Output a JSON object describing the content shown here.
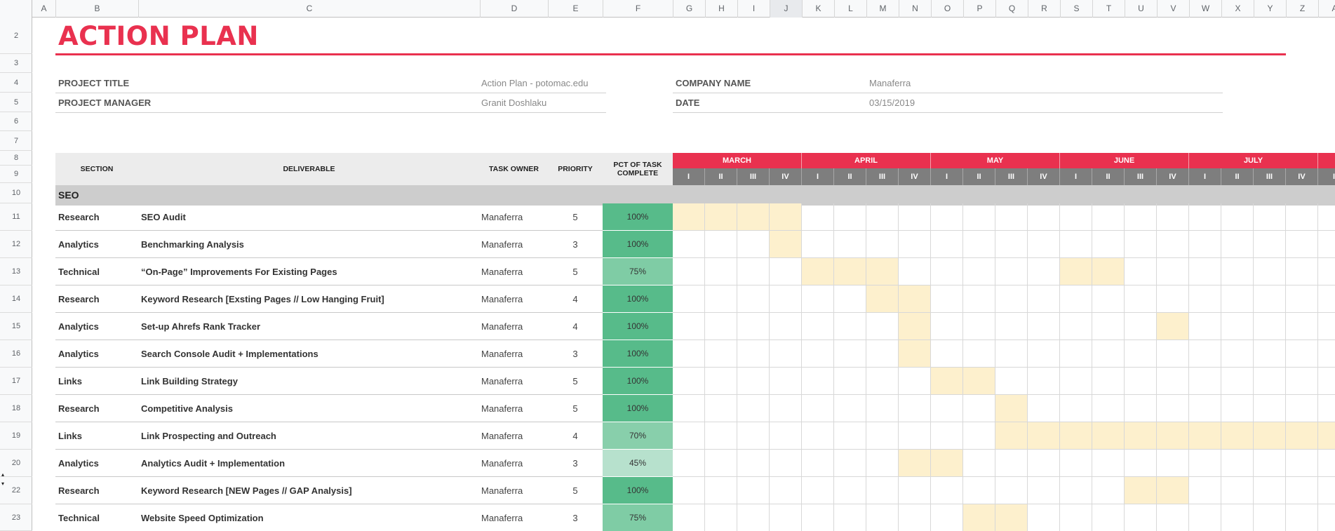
{
  "column_headers": [
    "A",
    "B",
    "C",
    "D",
    "E",
    "F",
    "G",
    "H",
    "I",
    "J",
    "K",
    "L",
    "M",
    "N",
    "O",
    "P",
    "Q",
    "R",
    "S",
    "T",
    "U",
    "V",
    "W",
    "X",
    "Y",
    "Z",
    "A"
  ],
  "selected_column": "J",
  "row_headers": [
    "2",
    "3",
    "4",
    "5",
    "6",
    "7",
    "8",
    "9",
    "10",
    "11",
    "12",
    "13",
    "14",
    "15",
    "16",
    "17",
    "18",
    "19",
    "20",
    "22",
    "23"
  ],
  "title": "ACTION PLAN",
  "info": {
    "project_title_label": "PROJECT TITLE",
    "project_title_value": "Action Plan - potomac.edu",
    "project_manager_label": "PROJECT MANAGER",
    "project_manager_value": "Granit Doshlaku",
    "company_name_label": "COMPANY NAME",
    "company_name_value": "Manaferra",
    "date_label": "DATE",
    "date_value": "03/15/2019"
  },
  "table_headers": {
    "section": "SECTION",
    "deliverable": "DELIVERABLE",
    "task_owner": "TASK OWNER",
    "priority": "PRIORITY",
    "pct_complete": "PCT OF TASK COMPLETE"
  },
  "months": [
    "MARCH",
    "APRIL",
    "MAY",
    "JUNE",
    "JULY",
    ""
  ],
  "weeks": [
    "I",
    "II",
    "III",
    "IV"
  ],
  "section_group": "SEO",
  "tasks": [
    {
      "section": "Research",
      "deliverable": "SEO Audit",
      "owner": "Manaferra",
      "priority": "5",
      "pct": "100%",
      "pct_value": 100,
      "weeks_active": [
        0,
        1,
        2,
        3
      ]
    },
    {
      "section": "Analytics",
      "deliverable": "Benchmarking Analysis",
      "owner": "Manaferra",
      "priority": "3",
      "pct": "100%",
      "pct_value": 100,
      "weeks_active": [
        3
      ]
    },
    {
      "section": "Technical",
      "deliverable": "“On-Page” Improvements For Existing Pages",
      "owner": "Manaferra",
      "priority": "5",
      "pct": "75%",
      "pct_value": 75,
      "weeks_active": [
        4,
        5,
        6,
        12,
        13
      ]
    },
    {
      "section": "Research",
      "deliverable": "Keyword Research [Exsting Pages // Low Hanging Fruit]",
      "owner": "Manaferra",
      "priority": "4",
      "pct": "100%",
      "pct_value": 100,
      "weeks_active": [
        6,
        7
      ]
    },
    {
      "section": "Analytics",
      "deliverable": "Set-up Ahrefs Rank Tracker",
      "owner": "Manaferra",
      "priority": "4",
      "pct": "100%",
      "pct_value": 100,
      "weeks_active": [
        7,
        15
      ]
    },
    {
      "section": "Analytics",
      "deliverable": "Search Console Audit + Implementations",
      "owner": "Manaferra",
      "priority": "3",
      "pct": "100%",
      "pct_value": 100,
      "weeks_active": [
        7
      ]
    },
    {
      "section": "Links",
      "deliverable": "Link Building Strategy",
      "owner": "Manaferra",
      "priority": "5",
      "pct": "100%",
      "pct_value": 100,
      "weeks_active": [
        8,
        9
      ]
    },
    {
      "section": "Research",
      "deliverable": "Competitive Analysis",
      "owner": "Manaferra",
      "priority": "5",
      "pct": "100%",
      "pct_value": 100,
      "weeks_active": [
        10
      ]
    },
    {
      "section": "Links",
      "deliverable": "Link Prospecting and Outreach",
      "owner": "Manaferra",
      "priority": "4",
      "pct": "70%",
      "pct_value": 70,
      "weeks_active": [
        10,
        11,
        12,
        13,
        14,
        15,
        16,
        17,
        18,
        19,
        20
      ]
    },
    {
      "section": "Analytics",
      "deliverable": "Analytics Audit + Implementation",
      "owner": "Manaferra",
      "priority": "3",
      "pct": "45%",
      "pct_value": 45,
      "weeks_active": [
        7,
        8
      ]
    },
    {
      "section": "Research",
      "deliverable": "Keyword Research [NEW Pages // GAP Analysis]",
      "owner": "Manaferra",
      "priority": "5",
      "pct": "100%",
      "pct_value": 100,
      "weeks_active": [
        14,
        15
      ]
    },
    {
      "section": "Technical",
      "deliverable": "Website Speed Optimization",
      "owner": "Manaferra",
      "priority": "3",
      "pct": "75%",
      "pct_value": 75,
      "weeks_active": [
        9,
        10
      ]
    }
  ],
  "colors": {
    "accent": "#e9314f",
    "week_header": "#7e7e7e",
    "gantt_fill": "#fdf0cd",
    "pct_100": "#57bb8a",
    "pct_75": "#7fcca5",
    "pct_70": "#88cfab",
    "pct_45": "#b7e1cd"
  }
}
